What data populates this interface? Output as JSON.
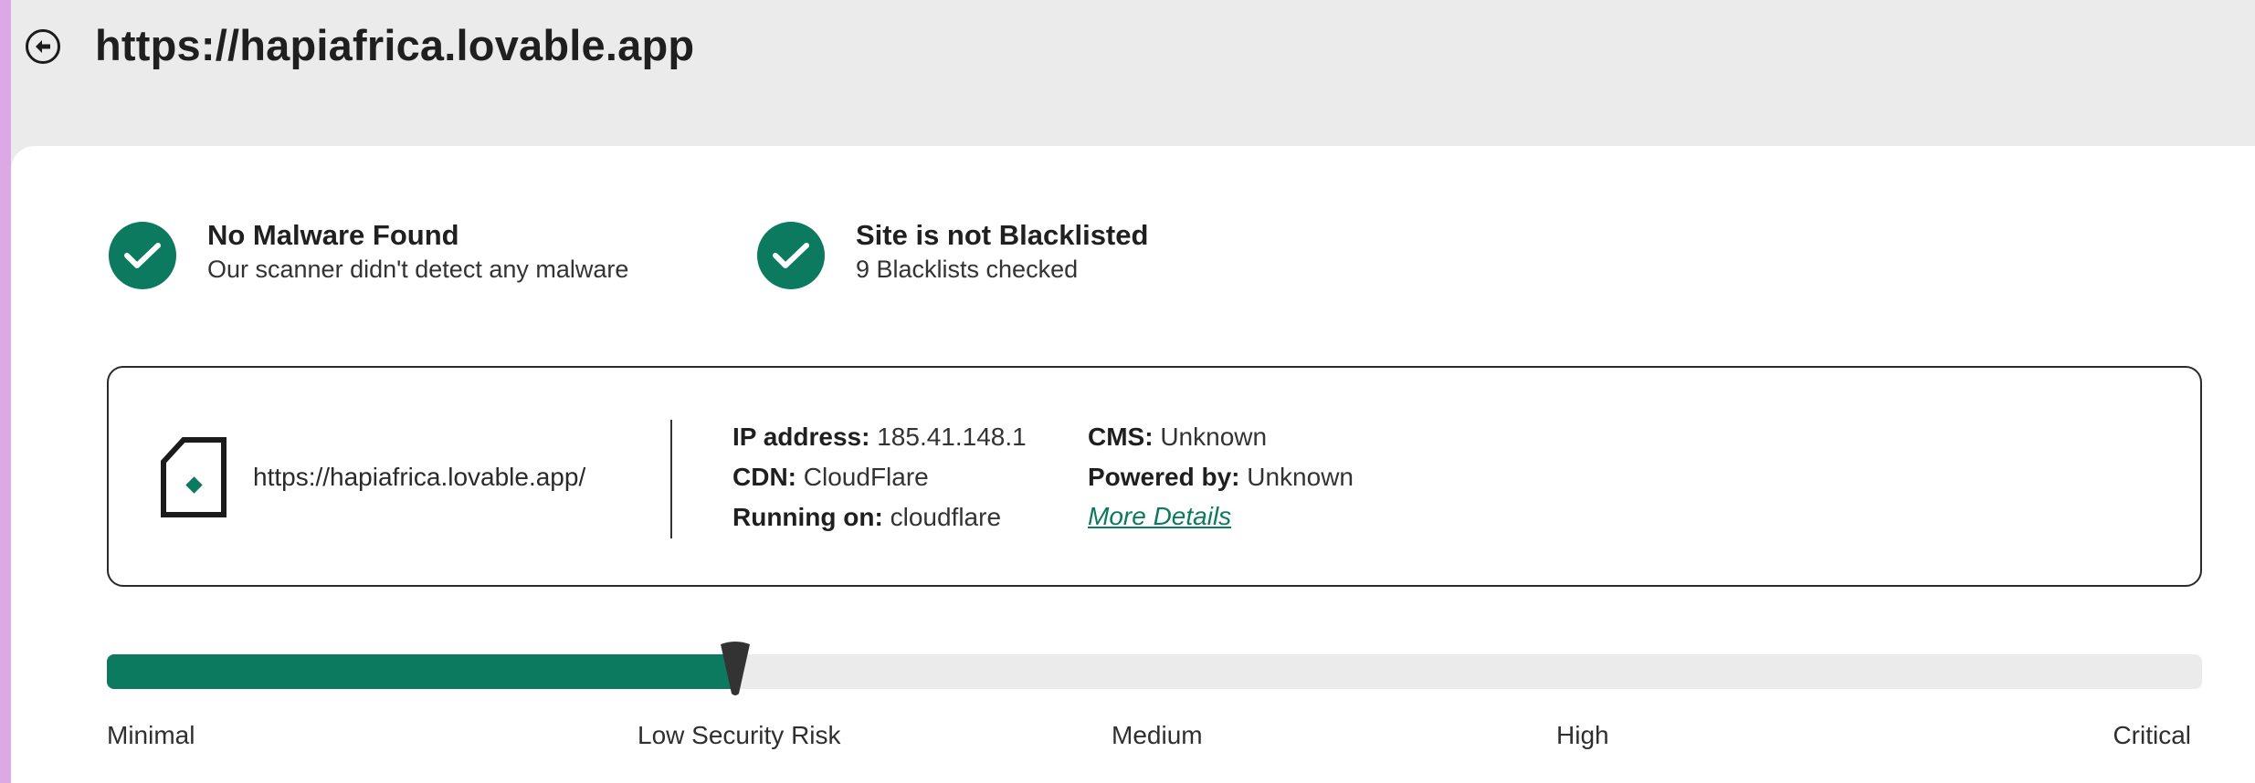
{
  "header": {
    "title": "https://hapiafrica.lovable.app",
    "back_icon": "arrow-left-circle-icon"
  },
  "status": [
    {
      "icon": "check-circle-icon",
      "title": "No Malware Found",
      "subtitle": "Our scanner didn't detect any malware"
    },
    {
      "icon": "check-circle-icon",
      "title": "Site is not Blacklisted",
      "subtitle": "9 Blacklists checked"
    }
  ],
  "site": {
    "icon": "document-icon",
    "url": "https://hapiafrica.lovable.app/",
    "ip_label": "IP address:",
    "ip": "185.41.148.1",
    "cdn_label": "CDN:",
    "cdn": "CloudFlare",
    "running_label": "Running on:",
    "running": "cloudflare",
    "cms_label": "CMS:",
    "cms": "Unknown",
    "powered_label": "Powered by:",
    "powered": "Unknown",
    "more_details": "More Details"
  },
  "risk": {
    "level_fraction": 0.3,
    "labels": [
      "Minimal",
      "Low Security Risk",
      "Medium",
      "High",
      "Critical"
    ],
    "fill_color": "#0b7a5e",
    "track_color": "#ebebeb"
  },
  "colors": {
    "accent": "#0b7a5e",
    "border_purple": "#dda8e6"
  }
}
